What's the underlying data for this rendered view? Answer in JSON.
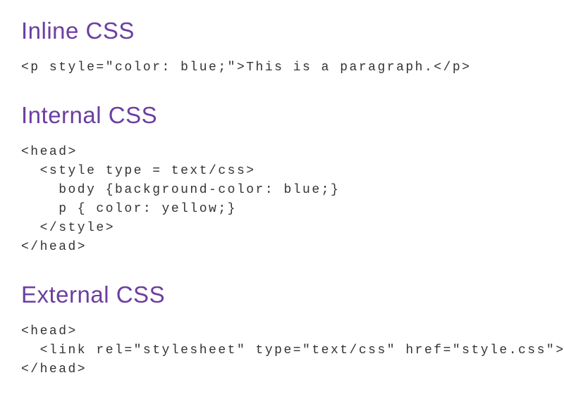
{
  "sections": {
    "inline": {
      "heading": "Inline CSS",
      "code": "<p style=\"color: blue;\">This is a paragraph.</p>"
    },
    "internal": {
      "heading": "Internal CSS",
      "code": "<head>\n  <style type = text/css>\n    body {background-color: blue;}\n    p { color: yellow;}\n  </style>\n</head>"
    },
    "external": {
      "heading": "External CSS",
      "code": "<head>\n  <link rel=\"stylesheet\" type=\"text/css\" href=\"style.css\">\n</head>"
    }
  }
}
